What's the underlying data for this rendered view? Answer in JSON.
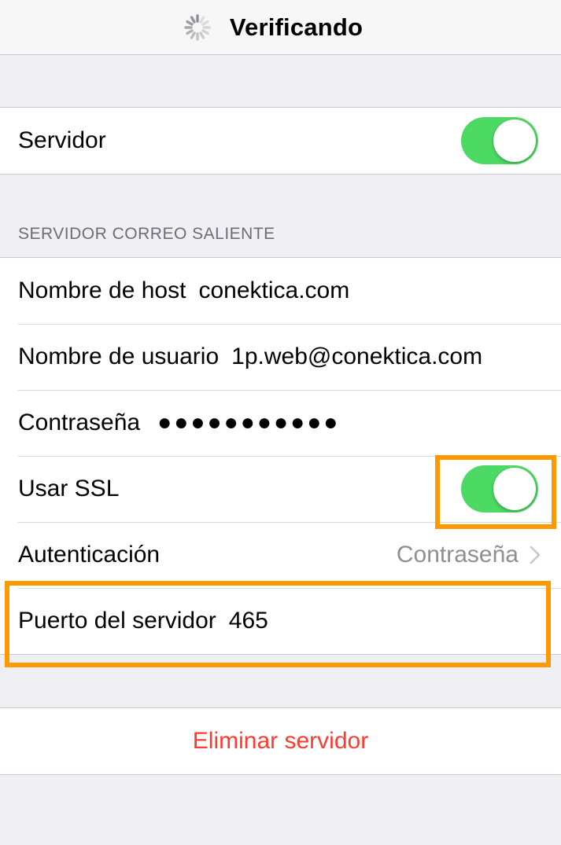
{
  "navbar": {
    "title": "Verificando",
    "spinner_icon": "activity-spinner-icon"
  },
  "server_group": {
    "label": "Servidor",
    "toggle_on": true
  },
  "outgoing_section": {
    "header": "SERVIDOR CORREO SALIENTE",
    "rows": {
      "hostname": {
        "label": "Nombre de host",
        "value": "conektica.com"
      },
      "username": {
        "label": "Nombre de usuario",
        "value": "1p.web@conektica.com"
      },
      "password": {
        "label": "Contraseña",
        "value": "●●●●●●●●●●●"
      },
      "ssl": {
        "label": "Usar SSL",
        "toggle_on": true
      },
      "auth": {
        "label": "Autenticación",
        "value": "Contraseña",
        "icon": "chevron-right-icon"
      },
      "port": {
        "label": "Puerto del servidor",
        "value": "465"
      }
    }
  },
  "delete": {
    "label": "Eliminar servidor"
  },
  "colors": {
    "toggle_on": "#4cd964",
    "destructive": "#ff3b30",
    "highlight": "#ff9900",
    "background": "#efeff4"
  }
}
